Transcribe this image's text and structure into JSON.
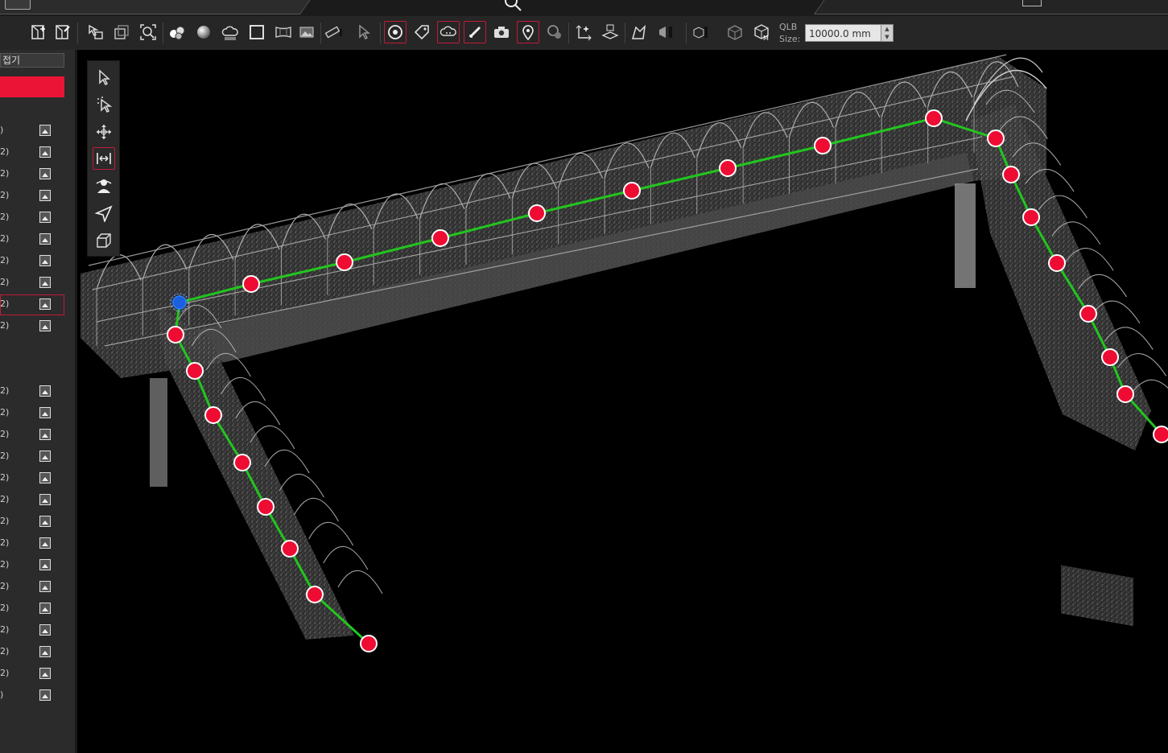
{
  "title_bar": {
    "center_text": "",
    "right_text": ""
  },
  "panel": {
    "collapse_label": "접기",
    "layers": [
      {
        "label": ")"
      },
      {
        "label": "2)"
      },
      {
        "label": "2)"
      },
      {
        "label": "2)"
      },
      {
        "label": "2)"
      },
      {
        "label": "2)"
      },
      {
        "label": "2)"
      },
      {
        "label": "2)"
      },
      {
        "label": "2)"
      },
      {
        "label": "2)"
      },
      {
        "label": "2)"
      },
      {
        "label": "2)"
      },
      {
        "label": "2)"
      },
      {
        "label": "2)"
      },
      {
        "label": "2)"
      },
      {
        "label": "2)"
      },
      {
        "label": "2)"
      },
      {
        "label": "2)"
      },
      {
        "label": "2)"
      },
      {
        "label": "2)"
      },
      {
        "label": "2)"
      },
      {
        "label": "2)"
      },
      {
        "label": "2)"
      },
      {
        "label": "2)"
      },
      {
        "label": ")"
      }
    ],
    "selected_index": 8
  },
  "toolbar": {
    "qlb_label": "QLB",
    "size_label": "Size:",
    "size_value": "10000.0 mm",
    "icons": [
      "layer-add-icon",
      "layer-edit-icon",
      "select-objects-icon",
      "window-icon",
      "zoom-extents-icon",
      "spheres-icon",
      "sphere-icon",
      "cloud-icon",
      "square-icon",
      "panorama-icon",
      "image-icon",
      "ruler-icon",
      "measure-cursor-icon",
      "target-icon",
      "tag-icon",
      "cloud-marker-icon",
      "measure-tool-icon",
      "camera-icon",
      "location-pin-icon",
      "geo-icon",
      "axis-add-icon",
      "plane-icon",
      "terrain-icon",
      "shape-icon",
      "box-select-icon",
      "cube-view-icon",
      "cube-m-icon"
    ],
    "active_icons": [
      "target-icon",
      "cloud-marker-icon",
      "measure-tool-icon",
      "location-pin-icon"
    ]
  },
  "palette": {
    "tools": [
      "select-arrow-icon",
      "select-point-icon",
      "orbit-icon",
      "fit-view-icon",
      "walk-icon",
      "fly-icon",
      "cube-icon"
    ],
    "active_tool": "fit-view-icon"
  },
  "path": {
    "line_color": "#22c51e",
    "node_color": "#ee0c33",
    "start_node_color": "#1a5fe0"
  }
}
